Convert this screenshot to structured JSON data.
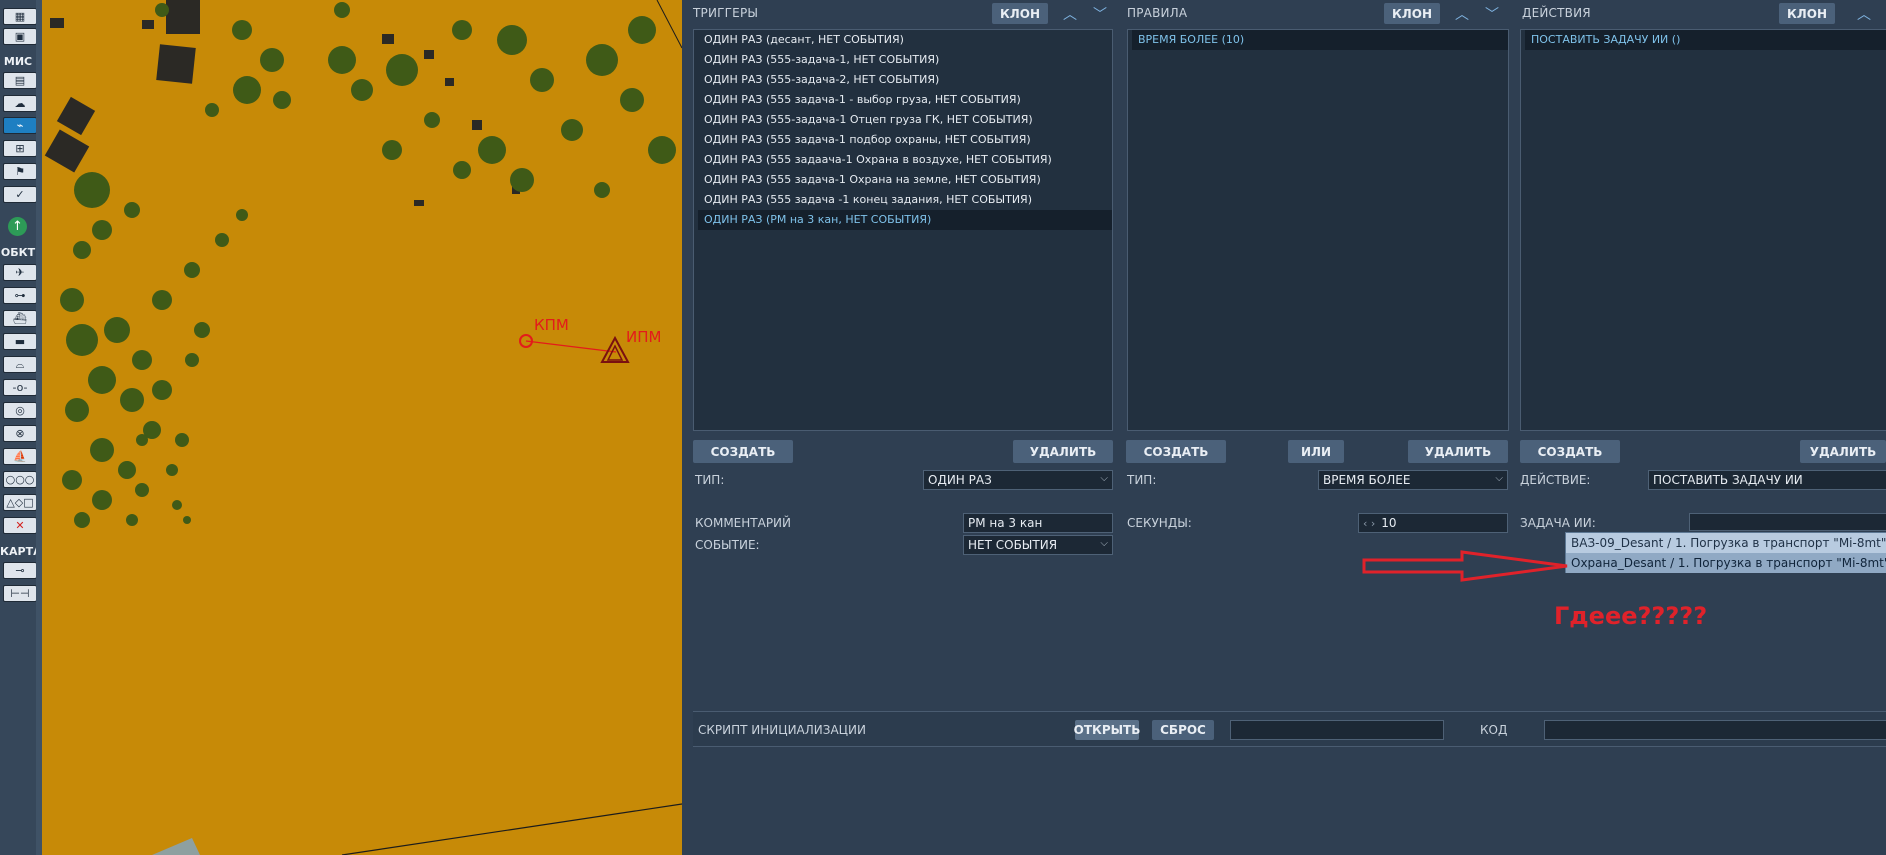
{
  "toolbar": {
    "sections": [
      "МИС",
      "ОБКТ",
      "КАРТА"
    ],
    "icons": [
      "building-icon",
      "save-icon",
      "clipboard-icon",
      "weather-icon",
      "trigger-icon",
      "target-icon",
      "flag-icon",
      "check-icon",
      "up-arrow-icon",
      "airplane-icon",
      "helicopter-icon",
      "ship-icon",
      "tank-icon",
      "bridge-icon",
      "waypoint-icon",
      "target-circle-icon",
      "x-circle-icon",
      "boat-icon",
      "formation-icon",
      "shapes-icon",
      "delete-icon",
      "key-icon",
      "ruler-icon"
    ]
  },
  "map": {
    "labels": {
      "kpm": "КПМ",
      "ipm": "ИПМ"
    },
    "colors": {
      "terrain": "#c78a07",
      "forest": "#3f5a17",
      "route": "#e31b1b"
    }
  },
  "triggers": {
    "title": "ТРИГГЕРЫ",
    "clone": "КЛОН",
    "items": [
      "ОДИН РАЗ (десант, НЕТ СОБЫТИЯ)",
      "ОДИН РАЗ (555-задача-1, НЕТ СОБЫТИЯ)",
      "ОДИН РАЗ (555-задача-2, НЕТ СОБЫТИЯ)",
      "ОДИН РАЗ (555 задача-1 - выбор груза, НЕТ СОБЫТИЯ)",
      "ОДИН РАЗ (555-задача-1 Отцеп груза ГК, НЕТ СОБЫТИЯ)",
      "ОДИН РАЗ (555 задача-1 подбор охраны, НЕТ СОБЫТИЯ)",
      "ОДИН РАЗ (555 задаача-1 Охрана в воздухе, НЕТ СОБЫТИЯ)",
      "ОДИН РАЗ (555 задача-1 Охрана на земле, НЕТ СОБЫТИЯ)",
      "ОДИН РАЗ (555 задача -1 конец задания, НЕТ СОБЫТИЯ)",
      "ОДИН РАЗ (РМ на 3 кан, НЕТ СОБЫТИЯ)"
    ],
    "create": "СОЗДАТЬ",
    "delete": "УДАЛИТЬ",
    "type_label": "ТИП:",
    "type_value": "ОДИН РАЗ",
    "comment_label": "КОММЕНТАРИЙ",
    "comment_value": "РМ на 3 кан",
    "event_label": "СОБЫТИЕ:",
    "event_value": "НЕТ СОБЫТИЯ"
  },
  "rules": {
    "title": "ПРАВИЛА",
    "clone": "КЛОН",
    "items": [
      "ВРЕМЯ БОЛЕЕ (10)"
    ],
    "create": "СОЗДАТЬ",
    "or": "ИЛИ",
    "delete": "УДАЛИТЬ",
    "type_label": "ТИП:",
    "type_value": "ВРЕМЯ БОЛЕЕ",
    "seconds_label": "СЕКУНДЫ:",
    "seconds_value": "10"
  },
  "actions": {
    "title": "ДЕЙСТВИЯ",
    "clone": "КЛОН",
    "items": [
      "ПОСТАВИТЬ ЗАДАЧУ ИИ ()"
    ],
    "create": "СОЗДАТЬ",
    "delete": "УДАЛИТЬ",
    "action_label": "ДЕЙСТВИЕ:",
    "action_value": "ПОСТАВИТЬ ЗАДАЧУ ИИ",
    "task_label": "ЗАДАЧА ИИ:",
    "dropdown_options": [
      "ВАЗ-09_Desant / 1. Погрузка в транспорт \"Mi-8mt\"",
      "Охрана_Desant / 1. Погрузка в транспорт \"Mi-8mt\""
    ]
  },
  "annotation": {
    "text": "Гдеее?????",
    "color": "#e0222a"
  },
  "init_script": {
    "label": "СКРИПТ ИНИЦИАЛИЗАЦИИ",
    "open": "ОТКРЫТЬ",
    "reset": "СБРОС",
    "code_label": "КОД"
  }
}
